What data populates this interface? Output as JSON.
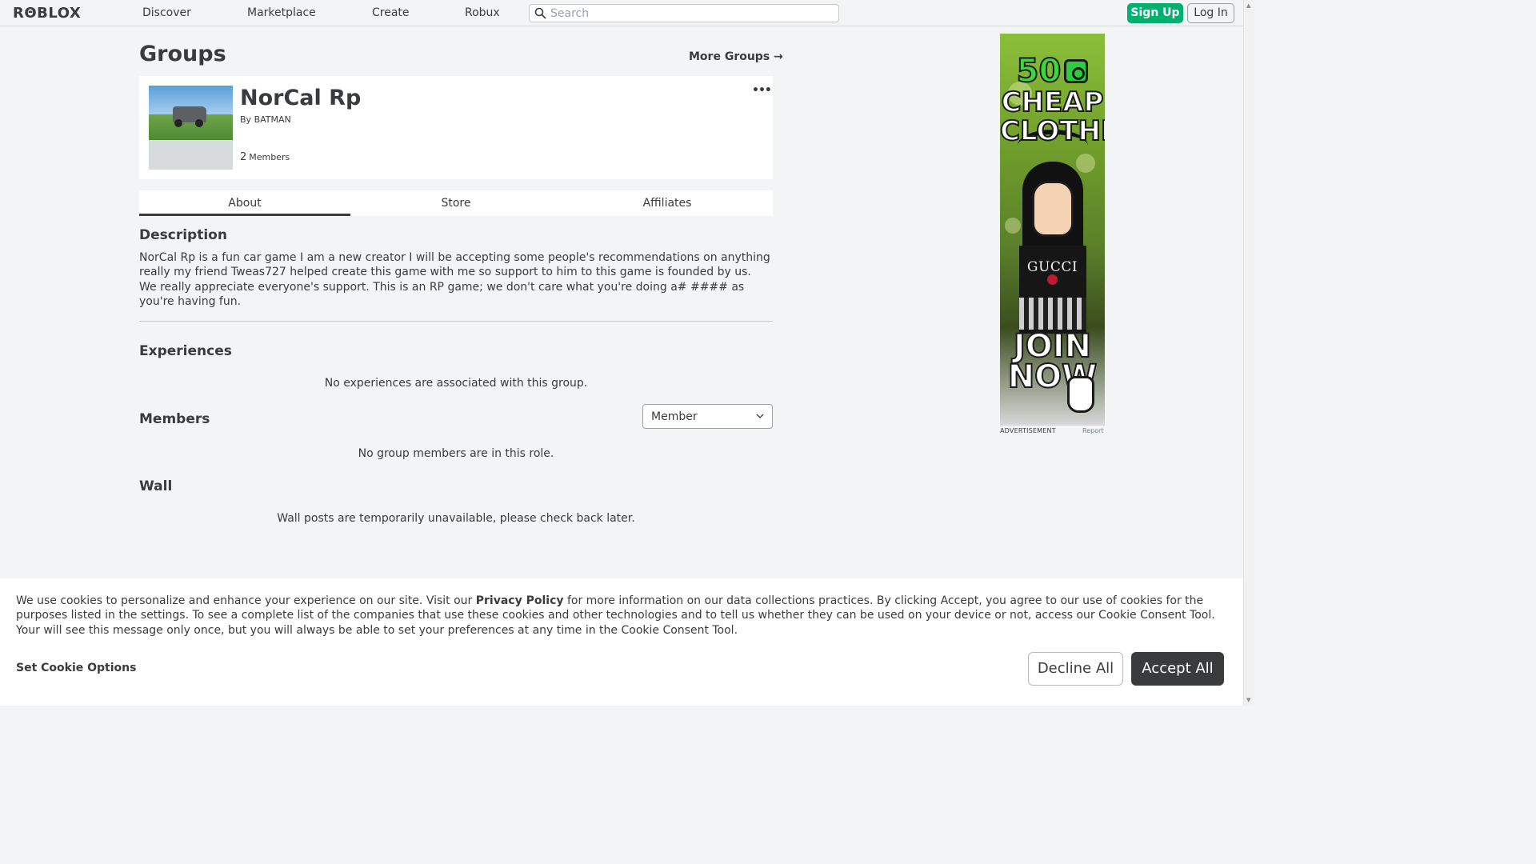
{
  "nav": {
    "logo": "RΘBLOX",
    "links": [
      "Discover",
      "Marketplace",
      "Create",
      "Robux"
    ],
    "search_placeholder": "Search",
    "signup_label": "Sign Up",
    "login_label": "Log In"
  },
  "page": {
    "title": "Groups",
    "more_groups": "More Groups →"
  },
  "group": {
    "name": "NorCal Rp",
    "by_prefix": "By",
    "owner": "BATMAN",
    "member_count": "2",
    "members_label": "Members",
    "more_icon": "•••"
  },
  "tabs": [
    {
      "label": "About",
      "active": true
    },
    {
      "label": "Store",
      "active": false
    },
    {
      "label": "Affiliates",
      "active": false
    }
  ],
  "about": {
    "description_heading": "Description",
    "description": "NorCal Rp is a fun car game I am a new creator I will be accepting some people's recommendations on anything really my friend Tweas727 helped create this game with me so support to him to this game is founded by us. We really appreciate everyone's support. This is an RP game; we don't care what you're doing a# #### as you're having fun.",
    "experiences_heading": "Experiences",
    "experiences_empty": "No experiences are associated with this group.",
    "members_heading": "Members",
    "role_selected": "Member",
    "members_empty": "No group members are in this role.",
    "wall_heading": "Wall",
    "wall_empty": "Wall posts are temporarily unavailable, please check back later."
  },
  "ad": {
    "headline_number": "50",
    "headline_text": "CHEAP CLOTHES",
    "brand": "GUCCI",
    "cta": "JOIN NOW",
    "label": "ADVERTISEMENT",
    "report": "Report"
  },
  "cookie": {
    "text_before": "We use cookies to personalize and enhance your experience on our site. Visit our ",
    "privacy_link": "Privacy Policy",
    "text_after": " for more information on our data collections practices. By clicking Accept, you agree to our use of cookies for the purposes listed in the settings. To see a complete list of the companies that use these cookies and other technologies and to tell us whether they can be used on your device or not, access our Cookie Consent Tool. Your will see this message only once, but you will always be able to set your preferences at any time in the Cookie Consent Tool.",
    "set_options": "Set Cookie Options",
    "decline": "Decline All",
    "accept": "Accept All"
  },
  "colors": {
    "signup_green": "#00b06f",
    "text_dark": "#393b3d",
    "page_bg": "#f2f4f5"
  }
}
